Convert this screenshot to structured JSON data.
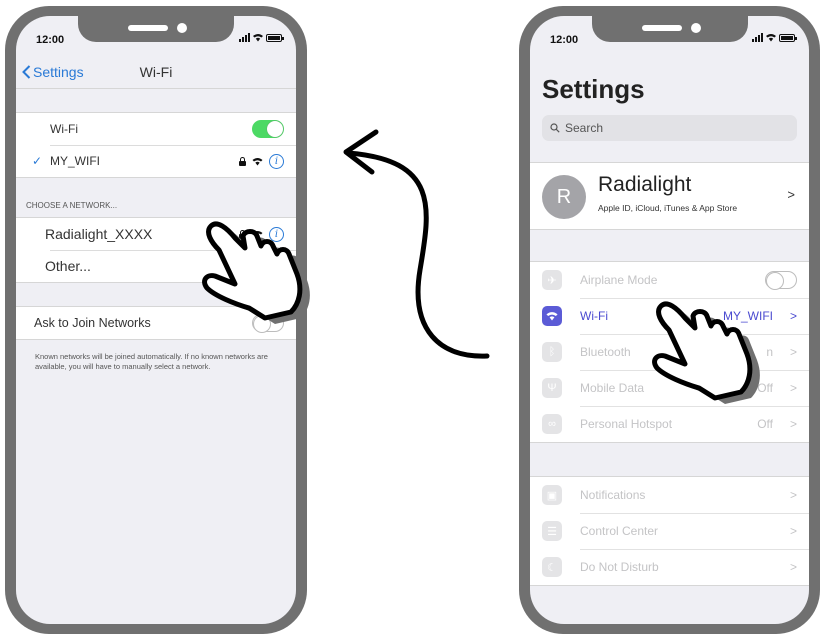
{
  "left_phone": {
    "status": {
      "time": "12:00"
    },
    "nav": {
      "back_label": "Settings",
      "title": "Wi-Fi"
    },
    "wifi_toggle": {
      "label": "Wi-Fi",
      "state": "on"
    },
    "connected": {
      "name": "MY_WIFI"
    },
    "choose_header": "CHOOSE A NETWORK...",
    "networks": [
      {
        "name": "Radialight_XXXX"
      },
      {
        "name": "Other..."
      }
    ],
    "ask_join": {
      "label": "Ask to Join Networks",
      "state": "off"
    },
    "footnote": "Known networks will be joined automatically. If no known networks are available, you will have to manually select a network."
  },
  "right_phone": {
    "status": {
      "time": "12:00"
    },
    "title": "Settings",
    "search": {
      "placeholder": "Search"
    },
    "profile": {
      "initial": "R",
      "name": "Radialight",
      "subtitle": "Apple ID, iCloud, iTunes & App Store"
    },
    "group1": [
      {
        "label": "Airplane Mode",
        "icon": "airplane-icon",
        "value": ""
      },
      {
        "label": "Wi-Fi",
        "icon": "wifi-icon",
        "value": "MY_WIFI"
      },
      {
        "label": "Bluetooth",
        "icon": "bluetooth-icon",
        "value": "n"
      },
      {
        "label": "Mobile Data",
        "icon": "antenna-icon",
        "value": "Off"
      },
      {
        "label": "Personal Hotspot",
        "icon": "hotspot-icon",
        "value": "Off"
      }
    ],
    "group2": [
      {
        "label": "Notifications",
        "icon": "notifications-icon"
      },
      {
        "label": "Control Center",
        "icon": "control-center-icon"
      },
      {
        "label": "Do Not Disturb",
        "icon": "moon-icon"
      }
    ],
    "chevron": ">"
  },
  "colors": {
    "accent_blue": "#2a7ad6",
    "toggle_green": "#4cd964",
    "wifi_purple": "#5b5bd6",
    "phone_frame": "#707070"
  }
}
